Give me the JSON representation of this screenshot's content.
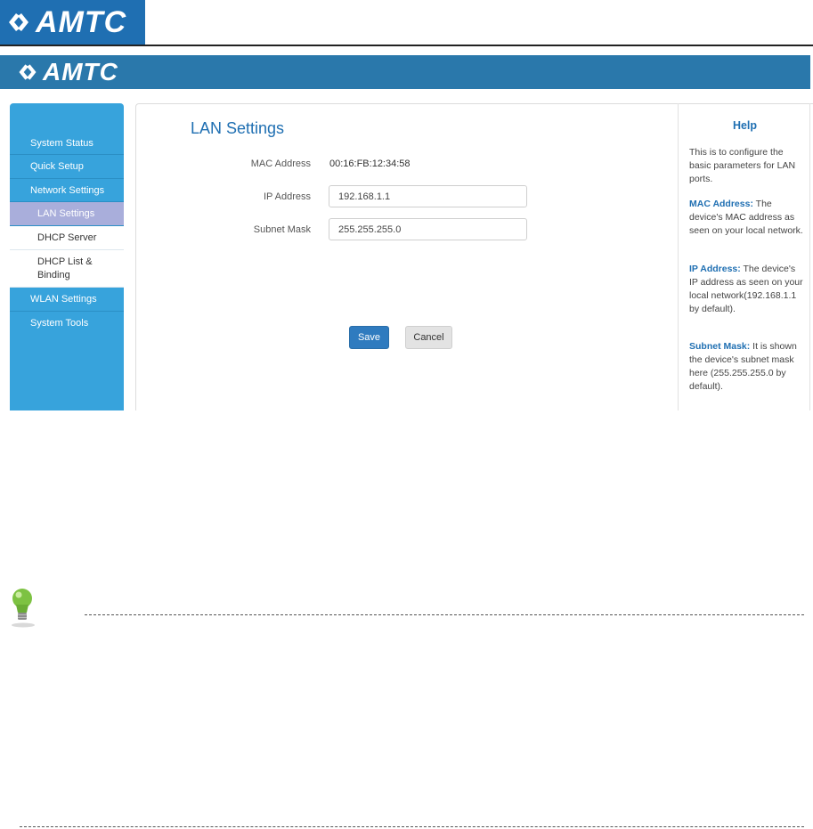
{
  "doc_header": {
    "logo_text": "AMTC"
  },
  "app": {
    "logo_text": "AMTC"
  },
  "sidebar": {
    "items": [
      {
        "label": "System Status"
      },
      {
        "label": "Quick Setup"
      },
      {
        "label": "Network Settings"
      },
      {
        "label": "LAN Settings",
        "active": true
      },
      {
        "label": "DHCP Server"
      },
      {
        "label": "DHCP List & Binding"
      },
      {
        "label": "WLAN Settings"
      },
      {
        "label": "System Tools"
      }
    ]
  },
  "main": {
    "title": "LAN Settings",
    "mac_label": "MAC Address",
    "mac_value": "00:16:FB:12:34:58",
    "ip_label": "IP Address",
    "ip_value": "192.168.1.1",
    "mask_label": "Subnet Mask",
    "mask_value": "255.255.255.0",
    "save_label": "Save",
    "cancel_label": "Cancel"
  },
  "help": {
    "title": "Help",
    "intro": "This is to configure the basic parameters for LAN ports.",
    "mac_key": "MAC Address:",
    "mac_text": " The device's MAC address as seen on your local network.",
    "ip_key": "IP Address:",
    "ip_text": " The device's IP address as seen on your local network(192.168.1.1 by default).",
    "mask_key": "Subnet Mask:",
    "mask_text": " It is shown the device's subnet mask here (255.255.255.0 by default)."
  },
  "colors": {
    "brand_blue": "#2a78ab",
    "sidebar_blue": "#37a3dc",
    "active_item": "#a9aedb",
    "save_button": "#2f7bbf",
    "tip_bulb": "#7dc242"
  },
  "icons": {
    "logo": "amtc-logo-icon",
    "tip": "lightbulb-icon"
  }
}
